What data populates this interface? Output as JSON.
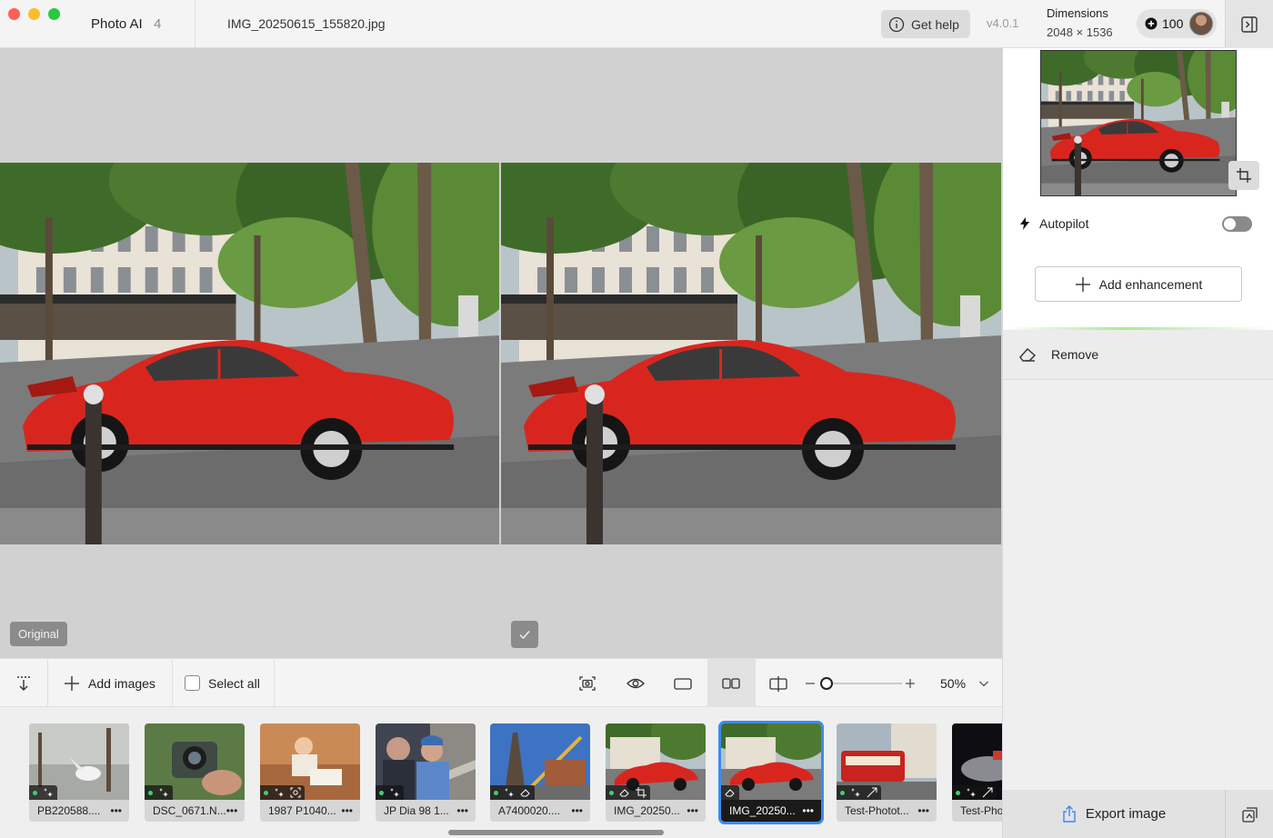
{
  "window": {
    "app_name": "Photo AI",
    "app_count": "4",
    "filename": "IMG_20250615_155820.jpg",
    "help_label": "Get help",
    "version": "v4.0.1",
    "dimensions_label": "Dimensions",
    "dimensions_value": "2048 × 1536",
    "credits": "100"
  },
  "canvas": {
    "original_label": "Original"
  },
  "toolbar": {
    "add_images_label": "Add images",
    "select_all_label": "Select all",
    "zoom_value": "50%",
    "zoom_level": 0.0
  },
  "filmstrip": {
    "items": [
      {
        "label": "PB220588....",
        "icons": [
          "enhance-icon"
        ]
      },
      {
        "label": "DSC_0671.N...",
        "icons": [
          "enhance-icon"
        ]
      },
      {
        "label": "1987 P1040...",
        "icons": [
          "enhance-icon",
          "face-icon"
        ]
      },
      {
        "label": "JP Dia 98 1...",
        "icons": [
          "enhance-icon"
        ]
      },
      {
        "label": "A7400020....",
        "icons": [
          "enhance-icon",
          "eraser-icon"
        ]
      },
      {
        "label": "IMG_20250...",
        "icons": [
          "eraser-icon",
          "crop-icon"
        ]
      },
      {
        "label": "IMG_20250...",
        "icons": [
          "eraser-icon"
        ],
        "selected": true
      },
      {
        "label": "Test-Photot...",
        "icons": [
          "enhance-icon",
          "upscale-icon"
        ]
      },
      {
        "label": "Test-Pho",
        "icons": [
          "enhance-icon",
          "upscale-icon"
        ]
      }
    ]
  },
  "panel": {
    "autopilot_label": "Autopilot",
    "autopilot_on": false,
    "add_enhancement_label": "Add enhancement",
    "remove_label": "Remove",
    "export_label": "Export image"
  },
  "colors": {
    "selection": "#3b8bf0",
    "car": "#d8261f",
    "status_dot": "#3fd16a"
  }
}
